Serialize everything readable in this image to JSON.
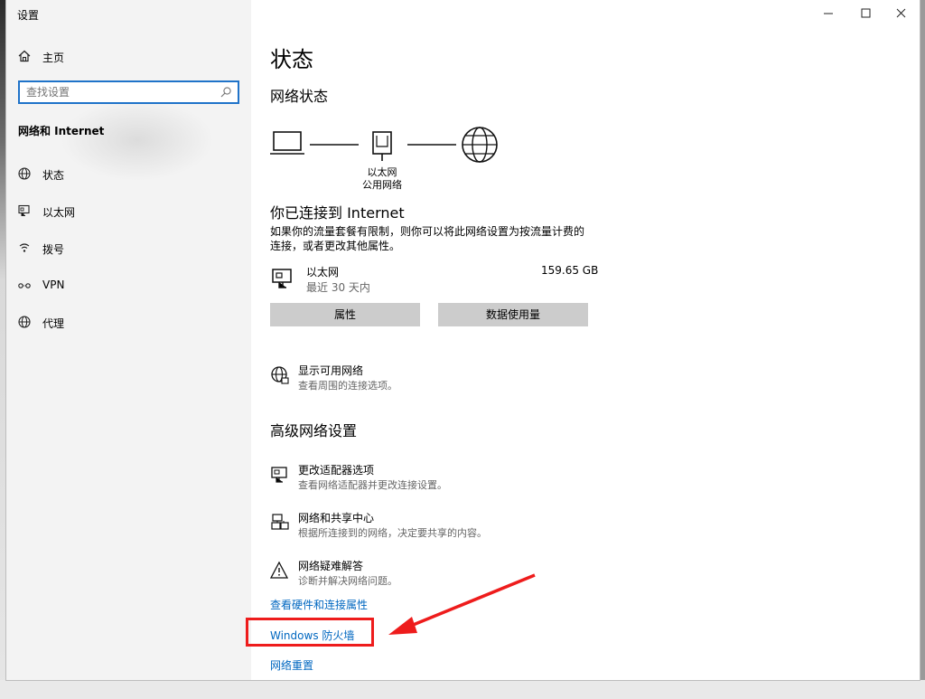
{
  "window": {
    "title": "设置"
  },
  "sidebar": {
    "home_label": "主页",
    "search_placeholder": "查找设置",
    "section_title": "网络和 Internet",
    "items": [
      {
        "label": "状态",
        "icon": "globe-icon"
      },
      {
        "label": "以太网",
        "icon": "ethernet-icon"
      },
      {
        "label": "拨号",
        "icon": "dialup-icon"
      },
      {
        "label": "VPN",
        "icon": "vpn-icon"
      },
      {
        "label": "代理",
        "icon": "globe-icon"
      }
    ]
  },
  "main": {
    "page_title": "状态",
    "network_status_heading": "网络状态",
    "diagram": {
      "adapter_label": "以太网",
      "network_label": "公用网络"
    },
    "connected_title": "你已连接到 Internet",
    "connected_desc_line1": "如果你的流量套餐有限制，则你可以将此网络设置为按流量计费的",
    "connected_desc_line2": "连接，或者更改其他属性。",
    "connection": {
      "name": "以太网",
      "period": "最近 30 天内",
      "usage": "159.65 GB"
    },
    "buttons": {
      "properties": "属性",
      "data_usage": "数据使用量"
    },
    "show_networks": {
      "title": "显示可用网络",
      "desc": "查看周围的连接选项。"
    },
    "advanced_heading": "高级网络设置",
    "advanced_items": [
      {
        "title": "更改适配器选项",
        "desc": "查看网络适配器并更改连接设置。",
        "icon": "adapter-icon"
      },
      {
        "title": "网络和共享中心",
        "desc": "根据所连接到的网络，决定要共享的内容。",
        "icon": "sharing-icon"
      },
      {
        "title": "网络疑难解答",
        "desc": "诊断并解决网络问题。",
        "icon": "warning-icon"
      }
    ],
    "links": {
      "hardware": "查看硬件和连接属性",
      "firewall": "Windows 防火墙",
      "reset": "网络重置"
    }
  },
  "colors": {
    "link": "#0067c0",
    "annotation": "#ee1c1c",
    "sidebar_bg": "#f3f3f3",
    "button_bg": "#cccccc"
  }
}
